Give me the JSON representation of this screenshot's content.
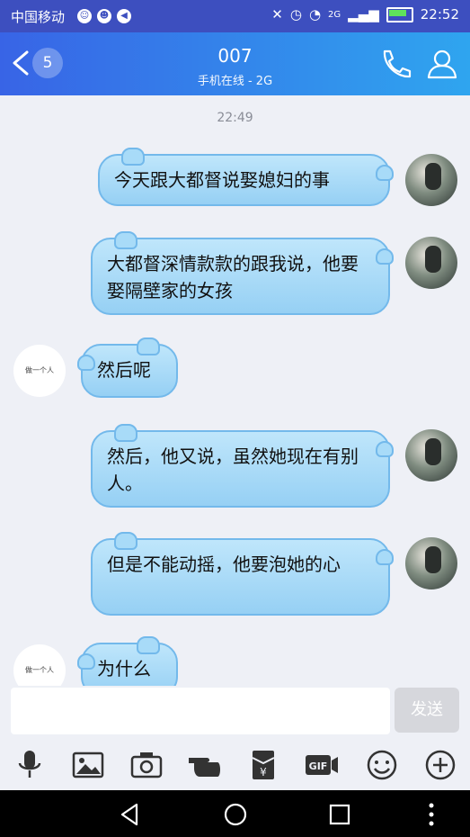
{
  "status_bar": {
    "carrier": "中国移动",
    "network_tag": "2G",
    "time": "22:52"
  },
  "header": {
    "back_badge": "5",
    "title": "007",
    "subtitle": "手机在线 - 2G"
  },
  "chat": {
    "timestamp": "22:49",
    "messages": [
      {
        "sender": "me",
        "text": "今天跟大都督说娶媳妇的事"
      },
      {
        "sender": "me",
        "text": "大都督深情款款的跟我说，他要娶隔壁家的女孩"
      },
      {
        "sender": "other",
        "text": "然后呢",
        "avatar_text": "做一个人"
      },
      {
        "sender": "me",
        "text": "然后，他又说，虽然她现在有别人。"
      },
      {
        "sender": "me",
        "text": "但是不能动摇，他要泡她的心"
      },
      {
        "sender": "other",
        "text": "为什么",
        "avatar_text": "做一个人"
      }
    ]
  },
  "input": {
    "placeholder": "",
    "send_label": "发送"
  },
  "toolbar": {
    "icons": [
      "microphone-icon",
      "image-icon",
      "camera-icon",
      "poke-icon",
      "red-packet-icon",
      "gif-icon",
      "emoji-icon",
      "plus-icon"
    ]
  },
  "colors": {
    "header_start": "#3864e6",
    "header_end": "#2fa5ef",
    "bubble": "#a8dbf8"
  }
}
